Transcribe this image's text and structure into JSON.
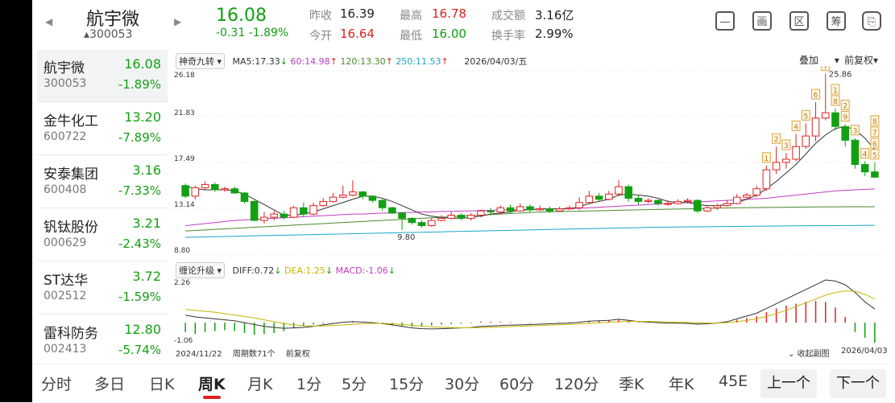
{
  "header": {
    "name": "航宇微",
    "code": "300053",
    "price": "16.08",
    "change": "-0.31",
    "change_pct": "-1.89%",
    "quote": {
      "prev_close_label": "昨收",
      "prev_close": "16.39",
      "open_label": "今开",
      "open": "16.64",
      "high_label": "最高",
      "high": "16.78",
      "low_label": "最低",
      "low": "16.00",
      "turnover_label": "成交额",
      "turnover": "3.16亿",
      "turnover_rate_label": "换手率",
      "turnover_rate": "2.99%"
    },
    "toolbar_icons": [
      "minus-square-icon",
      "picture-icon",
      "region-icon",
      "chip-icon",
      "phone-icon"
    ],
    "toolbar_labels": [
      "—",
      "画",
      "区",
      "筹",
      "⎘"
    ]
  },
  "watchlist": [
    {
      "name": "航宇微",
      "code": "300053",
      "price": "16.08",
      "change": "-1.89%"
    },
    {
      "name": "金牛化工",
      "code": "600722",
      "price": "13.20",
      "change": "-7.89%"
    },
    {
      "name": "安泰集团",
      "code": "600408",
      "price": "3.16",
      "change": "-7.33%"
    },
    {
      "name": "钒钛股份",
      "code": "000629",
      "price": "3.21",
      "change": "-2.43%"
    },
    {
      "name": "ST达华",
      "code": "002512",
      "price": "3.72",
      "change": "-1.59%"
    },
    {
      "name": "雷科防务",
      "code": "002413",
      "price": "12.80",
      "change": "-5.74%"
    }
  ],
  "chart": {
    "indicator_dropdown": "神奇九转",
    "ma5": "MA5:17.33",
    "ma60": "60:14.98",
    "ma120": "120:13.30",
    "ma250": "250:11.53",
    "date": "2026/04/03/五",
    "overlay_dropdown": "叠加",
    "adjust_dropdown": "前复权",
    "y_ticks": [
      "26.18",
      "21.83",
      "17.49",
      "13.14",
      "8.80"
    ],
    "high_label": "25.86",
    "low_label": "9.80",
    "macd_dropdown": "缠论升级",
    "diff": "DIFF:0.72",
    "dea": "DEA:1.25",
    "macd": "MACD:-1.06",
    "macd_top": "2.26",
    "macd_bottom": "-1.06",
    "start_date": "2024/11/22",
    "period_count": "周期数71个",
    "adjust_note": "前复权",
    "collapse": "收起副图",
    "end_date": "2026/04/03",
    "colors": {
      "up": "#e02020",
      "down": "#12a012",
      "ma5": "#333333",
      "ma60": "#c03cc0",
      "ma120": "#4a8a2a",
      "ma250": "#1aa6c8",
      "dea": "#c8b400"
    }
  },
  "chart_data": {
    "type": "candlestick",
    "ylim": [
      8.8,
      26.18
    ],
    "candles": [
      [
        15.3,
        14.3,
        15.5,
        14.1
      ],
      [
        14.3,
        15.1,
        15.3,
        14.0
      ],
      [
        15.1,
        15.4,
        15.7,
        14.9
      ],
      [
        15.4,
        14.9,
        15.6,
        14.7
      ],
      [
        14.9,
        15.0,
        15.2,
        14.7
      ],
      [
        15.0,
        14.6,
        15.2,
        14.5
      ],
      [
        14.6,
        13.8,
        14.7,
        13.6
      ],
      [
        13.8,
        12.0,
        13.9,
        11.9
      ],
      [
        12.0,
        12.3,
        12.8,
        11.7
      ],
      [
        12.3,
        12.6,
        12.9,
        12.0
      ],
      [
        12.6,
        12.3,
        12.9,
        12.1
      ],
      [
        12.3,
        13.2,
        13.4,
        12.2
      ],
      [
        13.2,
        12.6,
        13.7,
        12.4
      ],
      [
        12.6,
        13.4,
        13.7,
        12.5
      ],
      [
        13.4,
        13.8,
        14.1,
        13.3
      ],
      [
        13.8,
        14.2,
        14.6,
        13.7
      ],
      [
        14.2,
        14.4,
        15.3,
        14.1
      ],
      [
        14.4,
        14.7,
        15.8,
        14.3
      ],
      [
        14.7,
        14.3,
        14.8,
        14.0
      ],
      [
        14.3,
        13.9,
        14.4,
        13.7
      ],
      [
        13.9,
        13.2,
        14.0,
        12.9
      ],
      [
        13.2,
        12.7,
        13.3,
        12.6
      ],
      [
        12.7,
        12.2,
        12.8,
        11.1
      ],
      [
        12.2,
        11.8,
        12.3,
        11.6
      ],
      [
        11.8,
        11.5,
        12.0,
        11.3
      ],
      [
        11.5,
        12.0,
        12.2,
        11.4
      ],
      [
        12.0,
        12.2,
        12.5,
        11.9
      ],
      [
        12.2,
        12.5,
        12.8,
        12.1
      ],
      [
        12.5,
        12.2,
        12.7,
        12.0
      ],
      [
        12.2,
        12.5,
        12.7,
        12.0
      ],
      [
        12.5,
        12.9,
        13.0,
        12.3
      ],
      [
        12.9,
        12.8,
        13.2,
        12.5
      ],
      [
        12.8,
        13.2,
        13.4,
        12.6
      ],
      [
        13.2,
        12.9,
        13.5,
        12.7
      ],
      [
        12.9,
        13.3,
        13.6,
        12.8
      ],
      [
        13.3,
        13.0,
        13.5,
        12.8
      ],
      [
        13.0,
        13.1,
        13.4,
        12.9
      ],
      [
        13.1,
        12.9,
        13.3,
        12.7
      ],
      [
        12.9,
        13.1,
        13.3,
        12.8
      ],
      [
        13.1,
        13.2,
        13.4,
        13.0
      ],
      [
        13.2,
        13.7,
        14.2,
        13.0
      ],
      [
        13.7,
        14.3,
        14.8,
        13.6
      ],
      [
        14.3,
        14.0,
        14.6,
        13.8
      ],
      [
        14.0,
        14.5,
        14.8,
        13.9
      ],
      [
        14.5,
        15.2,
        15.8,
        14.3
      ],
      [
        15.2,
        14.1,
        15.4,
        13.8
      ],
      [
        14.1,
        13.8,
        14.4,
        13.5
      ],
      [
        13.8,
        13.9,
        14.1,
        13.6
      ],
      [
        13.9,
        13.6,
        14.0,
        13.4
      ],
      [
        13.6,
        13.6,
        13.9,
        13.4
      ],
      [
        13.6,
        13.8,
        14.0,
        13.5
      ],
      [
        13.8,
        13.9,
        14.1,
        13.6
      ],
      [
        13.9,
        12.9,
        14.0,
        12.7
      ],
      [
        12.9,
        13.2,
        13.4,
        12.8
      ],
      [
        13.2,
        13.4,
        13.6,
        13.0
      ],
      [
        13.4,
        13.6,
        13.9,
        13.3
      ],
      [
        13.6,
        14.2,
        14.5,
        13.5
      ],
      [
        14.2,
        14.4,
        14.6,
        14.0
      ],
      [
        14.4,
        15.0,
        15.3,
        14.2
      ],
      [
        15.0,
        16.8,
        17.2,
        14.8
      ],
      [
        16.8,
        17.5,
        19.0,
        16.4
      ],
      [
        17.5,
        17.8,
        18.4,
        16.9
      ],
      [
        17.8,
        19.0,
        20.2,
        17.6
      ],
      [
        19.0,
        20.0,
        21.2,
        18.8
      ],
      [
        20.0,
        21.7,
        23.2,
        19.5
      ],
      [
        21.7,
        22.2,
        25.9,
        21.5
      ],
      [
        22.2,
        20.9,
        22.6,
        20.5
      ],
      [
        20.9,
        19.6,
        21.1,
        19.0
      ],
      [
        19.6,
        17.3,
        19.8,
        16.9
      ],
      [
        17.3,
        16.6,
        17.6,
        16.2
      ],
      [
        16.6,
        16.1,
        17.5,
        16.0
      ]
    ],
    "ma5": [
      15.3,
      15.0,
      14.9,
      14.9,
      14.9,
      14.8,
      14.5,
      14.0,
      13.5,
      13.0,
      12.5,
      12.5,
      12.6,
      12.8,
      13.1,
      13.4,
      13.7,
      14.0,
      14.3,
      14.3,
      14.1,
      13.8,
      13.4,
      13.0,
      12.6,
      12.4,
      12.3,
      12.2,
      12.2,
      12.3,
      12.4,
      12.6,
      12.7,
      12.8,
      13.0,
      13.0,
      13.1,
      13.1,
      13.1,
      13.1,
      13.3,
      13.6,
      13.8,
      14.0,
      14.4,
      14.5,
      14.4,
      14.3,
      14.1,
      13.8,
      13.7,
      13.7,
      13.5,
      13.4,
      13.4,
      13.5,
      13.7,
      14.0,
      14.4,
      15.0,
      15.7,
      16.5,
      17.3,
      18.3,
      19.3,
      20.1,
      20.7,
      20.9,
      20.6,
      19.8,
      18.7
    ],
    "ma60": [
      11.5,
      11.6,
      11.7,
      11.8,
      11.9,
      12.0,
      12.05,
      12.1,
      12.15,
      12.2,
      12.25,
      12.3,
      12.35,
      12.4,
      12.45,
      12.5,
      12.55,
      12.6,
      12.6,
      12.65,
      12.7,
      12.7,
      12.75,
      12.75,
      12.8,
      12.8,
      12.85,
      12.85,
      12.9,
      12.9,
      12.95,
      12.95,
      13.0,
      13.0,
      13.0,
      13.05,
      13.05,
      13.1,
      13.1,
      13.1,
      13.15,
      13.2,
      13.25,
      13.3,
      13.35,
      13.4,
      13.45,
      13.5,
      13.55,
      13.6,
      13.65,
      13.7,
      13.75,
      13.8,
      13.85,
      13.9,
      13.95,
      14.0,
      14.05,
      14.1,
      14.2,
      14.3,
      14.4,
      14.5,
      14.6,
      14.7,
      14.8,
      14.85,
      14.9,
      14.95,
      14.98
    ],
    "ma120": [
      11.0,
      11.05,
      11.1,
      11.15,
      11.2,
      11.25,
      11.3,
      11.35,
      11.4,
      11.45,
      11.5,
      11.55,
      11.6,
      11.65,
      11.7,
      11.75,
      11.8,
      11.85,
      11.9,
      11.95,
      12.0,
      12.05,
      12.1,
      12.15,
      12.2,
      12.25,
      12.3,
      12.35,
      12.4,
      12.45,
      12.5,
      12.55,
      12.6,
      12.65,
      12.7,
      12.75,
      12.8,
      12.82,
      12.84,
      12.86,
      12.88,
      12.9,
      12.92,
      12.94,
      12.96,
      12.98,
      13.0,
      13.02,
      13.04,
      13.06,
      13.08,
      13.1,
      13.12,
      13.14,
      13.16,
      13.18,
      13.2,
      13.21,
      13.22,
      13.23,
      13.24,
      13.25,
      13.26,
      13.27,
      13.28,
      13.29,
      13.29,
      13.3,
      13.3,
      13.3,
      13.3
    ],
    "ma250": [
      10.4,
      10.42,
      10.44,
      10.46,
      10.48,
      10.5,
      10.52,
      10.54,
      10.56,
      10.58,
      10.6,
      10.62,
      10.64,
      10.66,
      10.68,
      10.7,
      10.72,
      10.74,
      10.76,
      10.78,
      10.8,
      10.82,
      10.84,
      10.86,
      10.88,
      10.9,
      10.92,
      10.94,
      10.96,
      10.98,
      11.0,
      11.02,
      11.04,
      11.06,
      11.08,
      11.1,
      11.12,
      11.14,
      11.16,
      11.18,
      11.2,
      11.22,
      11.24,
      11.26,
      11.28,
      11.3,
      11.32,
      11.34,
      11.35,
      11.36,
      11.37,
      11.38,
      11.39,
      11.4,
      11.41,
      11.42,
      11.43,
      11.44,
      11.45,
      11.46,
      11.47,
      11.48,
      11.49,
      11.5,
      11.5,
      11.51,
      11.51,
      11.52,
      11.52,
      11.53,
      11.53
    ],
    "nine_turn": [
      [
        59,
        "1"
      ],
      [
        60,
        "2"
      ],
      [
        61,
        "3"
      ],
      [
        62,
        "4"
      ],
      [
        63,
        "5"
      ],
      [
        64,
        "6"
      ],
      [
        65,
        "7"
      ],
      [
        66,
        "8"
      ],
      [
        67,
        "9"
      ],
      [
        66,
        "1"
      ],
      [
        67,
        "2"
      ],
      [
        68,
        "3"
      ],
      [
        69,
        "4"
      ],
      [
        70,
        "5"
      ],
      [
        70,
        "6"
      ],
      [
        70,
        "7"
      ],
      [
        70,
        "8"
      ]
    ],
    "macd_hist": [
      -0.5,
      -0.6,
      -0.5,
      -0.45,
      -0.4,
      -0.45,
      -0.55,
      -0.65,
      -0.6,
      -0.55,
      -0.45,
      -0.3,
      -0.2,
      -0.1,
      -0.05,
      0.02,
      0.04,
      0.05,
      0.03,
      -0.02,
      -0.08,
      -0.15,
      -0.2,
      -0.22,
      -0.2,
      -0.15,
      -0.1,
      -0.08,
      -0.06,
      -0.04,
      0.06,
      0.05,
      0.04,
      0.03,
      -0.02,
      -0.03,
      -0.01,
      0.01,
      0.02,
      0.03,
      0.05,
      0.08,
      0.1,
      0.12,
      0.15,
      0.1,
      0.05,
      0.02,
      -0.02,
      -0.04,
      -0.05,
      -0.04,
      -0.05,
      -0.02,
      0.02,
      0.05,
      0.15,
      0.25,
      0.35,
      0.55,
      0.75,
      0.9,
      1.0,
      1.1,
      1.15,
      1.1,
      0.8,
      0.3,
      -0.5,
      -0.8,
      -1.06
    ],
    "diff": [
      0.4,
      0.3,
      0.25,
      0.2,
      0.15,
      0.1,
      0.0,
      -0.1,
      -0.2,
      -0.25,
      -0.3,
      -0.28,
      -0.25,
      -0.2,
      -0.12,
      -0.05,
      0.02,
      0.05,
      0.03,
      0.0,
      -0.05,
      -0.12,
      -0.2,
      -0.28,
      -0.32,
      -0.33,
      -0.32,
      -0.3,
      -0.28,
      -0.26,
      -0.2,
      -0.18,
      -0.15,
      -0.13,
      -0.12,
      -0.1,
      -0.08,
      -0.06,
      -0.04,
      -0.02,
      0.02,
      0.08,
      0.1,
      0.12,
      0.18,
      0.12,
      0.06,
      0.03,
      0.0,
      -0.02,
      -0.03,
      -0.04,
      -0.08,
      -0.06,
      -0.02,
      0.05,
      0.2,
      0.35,
      0.5,
      0.75,
      1.0,
      1.25,
      1.5,
      1.75,
      2.0,
      2.26,
      2.2,
      2.0,
      1.6,
      1.1,
      0.72
    ],
    "dea": [
      0.7,
      0.65,
      0.6,
      0.55,
      0.48,
      0.4,
      0.33,
      0.25,
      0.15,
      0.05,
      -0.05,
      -0.12,
      -0.16,
      -0.18,
      -0.17,
      -0.15,
      -0.12,
      -0.09,
      -0.06,
      -0.04,
      -0.04,
      -0.06,
      -0.1,
      -0.14,
      -0.18,
      -0.22,
      -0.24,
      -0.26,
      -0.27,
      -0.27,
      -0.26,
      -0.25,
      -0.23,
      -0.21,
      -0.19,
      -0.17,
      -0.15,
      -0.13,
      -0.11,
      -0.09,
      -0.07,
      -0.04,
      -0.01,
      0.02,
      0.05,
      0.07,
      0.07,
      0.06,
      0.05,
      0.03,
      0.02,
      0.01,
      -0.01,
      -0.02,
      -0.02,
      0.0,
      0.05,
      0.12,
      0.2,
      0.33,
      0.48,
      0.65,
      0.85,
      1.05,
      1.25,
      1.45,
      1.6,
      1.68,
      1.66,
      1.5,
      1.25
    ]
  },
  "tabs": [
    "分时",
    "多日",
    "日K",
    "周K",
    "月K",
    "1分",
    "5分",
    "15分",
    "30分",
    "60分",
    "120分",
    "季K",
    "年K",
    "45E"
  ],
  "active_tab": "周K",
  "prev_btn": "上一个",
  "next_btn": "下一个"
}
